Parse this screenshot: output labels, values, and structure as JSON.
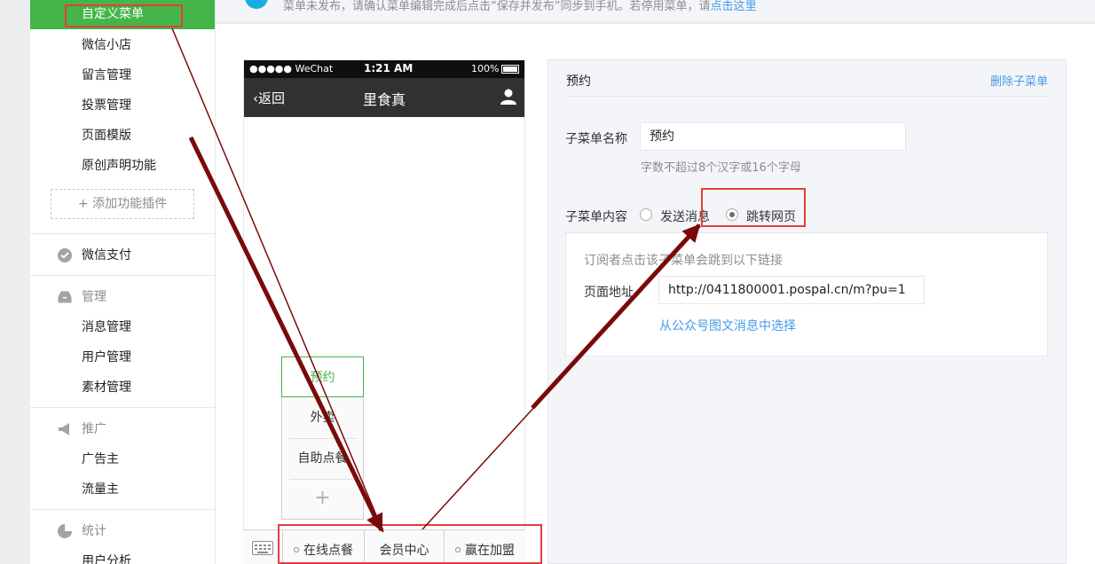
{
  "sidebar": {
    "items": [
      {
        "label": "自定义菜单"
      },
      {
        "label": "微信小店"
      },
      {
        "label": "留言管理"
      },
      {
        "label": "投票管理"
      },
      {
        "label": "页面模版"
      },
      {
        "label": "原创声明功能"
      }
    ],
    "add_plugin": "+ 添加功能插件",
    "wechat_pay": "微信支付",
    "manage": {
      "title": "管理",
      "items": [
        "消息管理",
        "用户管理",
        "素材管理"
      ]
    },
    "promo": {
      "title": "推广",
      "items": [
        "广告主",
        "流量主"
      ]
    },
    "stats": {
      "title": "统计",
      "items": [
        "用户分析"
      ]
    }
  },
  "notice": {
    "text": "菜单未发布，请确认菜单编辑完成后点击“保存并发布”同步到手机。若停用菜单，请",
    "link": "点击这里"
  },
  "phone": {
    "carrier": "●●●●● WeChat",
    "time": "1:21 AM",
    "battery": "100%",
    "back": "返回",
    "title": "里食真",
    "submenu": [
      "预约",
      "外卖",
      "自助点餐"
    ],
    "submenu_add": "+",
    "menus": [
      "在线点餐",
      "会员中心",
      "赢在加盟"
    ]
  },
  "editor": {
    "title": "预约",
    "delete": "删除子菜单",
    "name_label": "子菜单名称",
    "name_value": "预约",
    "name_tip": "字数不超过8个汉字或16个字母",
    "content_label": "子菜单内容",
    "options": [
      "发送消息",
      "跳转网页"
    ],
    "selected_option": "跳转网页",
    "url_tip": "订阅者点击该子菜单会跳到以下链接",
    "url_label": "页面地址",
    "url_value": "http://0411800001.pospal.cn/m?pu=1",
    "choose_link": "从公众号图文消息中选择"
  },
  "colors": {
    "accent": "#44b549",
    "link": "#459ae9",
    "highlight": "#e43d3d",
    "arrow": "#7a0a0a"
  }
}
